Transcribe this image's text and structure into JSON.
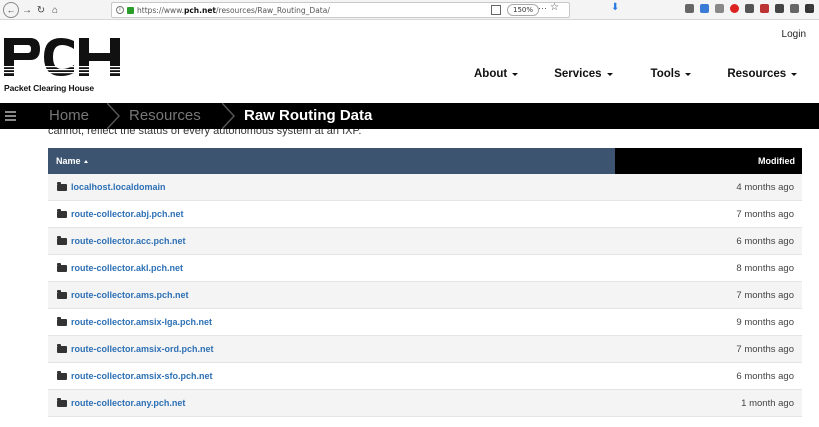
{
  "browser": {
    "url_prefix": "https://www.",
    "url_host": "pch.net",
    "url_path": "/resources/Raw_Routing_Data/",
    "zoom": "150%",
    "more": "···"
  },
  "site": {
    "login": "Login",
    "logo_letters": "PCH",
    "logo_name": "Packet Clearing House",
    "nav": [
      "About",
      "Services",
      "Tools",
      "Resources"
    ]
  },
  "breadcrumb": {
    "items": [
      "Home",
      "Resources",
      "Raw Routing Data"
    ]
  },
  "partial_text": "cannot, reflect the status of every autonomous system at an IXP.",
  "table": {
    "col_name": "Name",
    "col_modified": "Modified",
    "rows": [
      {
        "name": "localhost.localdomain",
        "modified": "4 months ago"
      },
      {
        "name": "route-collector.abj.pch.net",
        "modified": "7 months ago"
      },
      {
        "name": "route-collector.acc.pch.net",
        "modified": "6 months ago"
      },
      {
        "name": "route-collector.akl.pch.net",
        "modified": "8 months ago"
      },
      {
        "name": "route-collector.ams.pch.net",
        "modified": "7 months ago"
      },
      {
        "name": "route-collector.amsix-lga.pch.net",
        "modified": "9 months ago"
      },
      {
        "name": "route-collector.amsix-ord.pch.net",
        "modified": "7 months ago"
      },
      {
        "name": "route-collector.amsix-sfo.pch.net",
        "modified": "6 months ago"
      },
      {
        "name": "route-collector.any.pch.net",
        "modified": "1 month ago"
      }
    ]
  },
  "colors": {
    "header_blue": "#3d5470",
    "link_blue": "#2d70b5",
    "bar_black": "#000000"
  }
}
